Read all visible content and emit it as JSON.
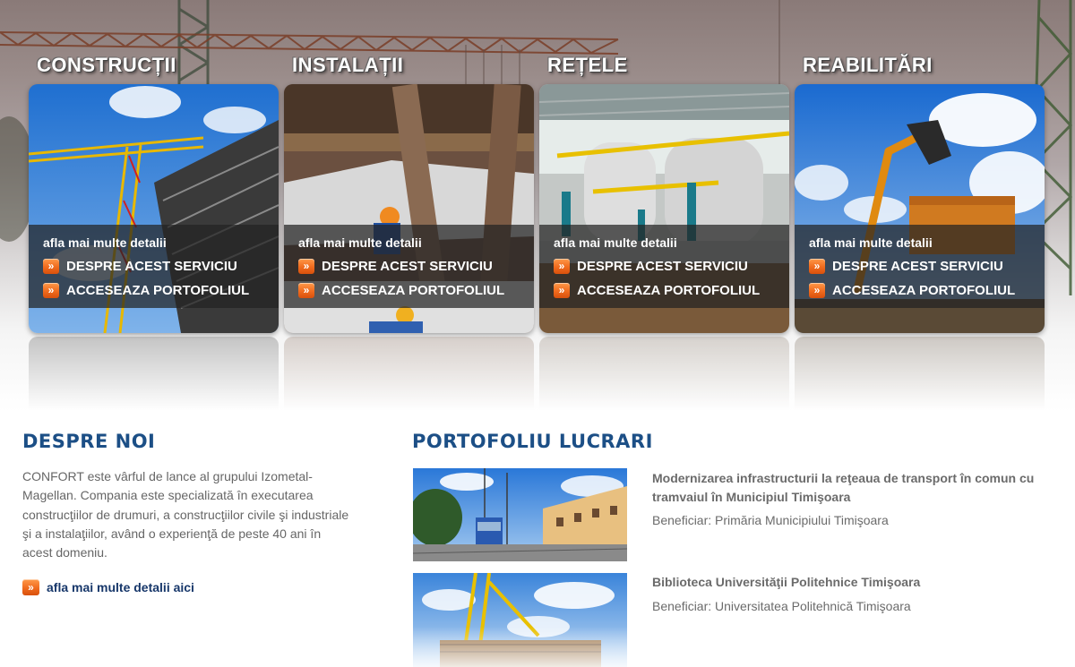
{
  "hero": {
    "services": [
      {
        "title": "CONSTRUCȚII",
        "more": "afla mai multe detalii",
        "link_about": "DESPRE ACEST SERVICIU",
        "link_portfolio": "ACCESEAZA PORTOFOLIUL"
      },
      {
        "title": "INSTALAȚII",
        "more": "afla mai multe detalii",
        "link_about": "DESPRE ACEST SERVICIU",
        "link_portfolio": "ACCESEAZA PORTOFOLIUL"
      },
      {
        "title": "REȚELE",
        "more": "afla mai multe detalii",
        "link_about": "DESPRE ACEST SERVICIU",
        "link_portfolio": "ACCESEAZA PORTOFOLIUL"
      },
      {
        "title": "REABILITĂRI",
        "more": "afla mai multe detalii",
        "link_about": "DESPRE ACEST SERVICIU",
        "link_portfolio": "ACCESEAZA PORTOFOLIUL"
      }
    ],
    "arrow_glyph": "»"
  },
  "about": {
    "title": "DESPRE NOI",
    "text": "CONFORT este vârful de lance al grupului Izometal-Magellan. Compania este specializată în executarea construcţiilor de drumuri, a construcţiilor civile şi industriale şi a instalaţiilor, având o experienţă de peste 40 ani în acest domeniu.",
    "more_link": "afla mai multe detalii aici"
  },
  "portfolio": {
    "title": "PORTOFOLIU LUCRARI",
    "items": [
      {
        "title": "Modernizarea infrastructurii la reţeaua de transport în comun cu tramvaiul în Municipiul Timişoara",
        "beneficiary": "Beneficiar: Primăria Municipiului Timişoara"
      },
      {
        "title": "Biblioteca Universităţii Politehnice Timişoara",
        "beneficiary": "Beneficiar: Universitatea Politehnică Timişoara"
      }
    ]
  },
  "colors": {
    "heading_blue": "#1c4f86",
    "link_navy": "#17376a",
    "body_gray": "#666666",
    "arrow_orange": "#f06b1e"
  }
}
